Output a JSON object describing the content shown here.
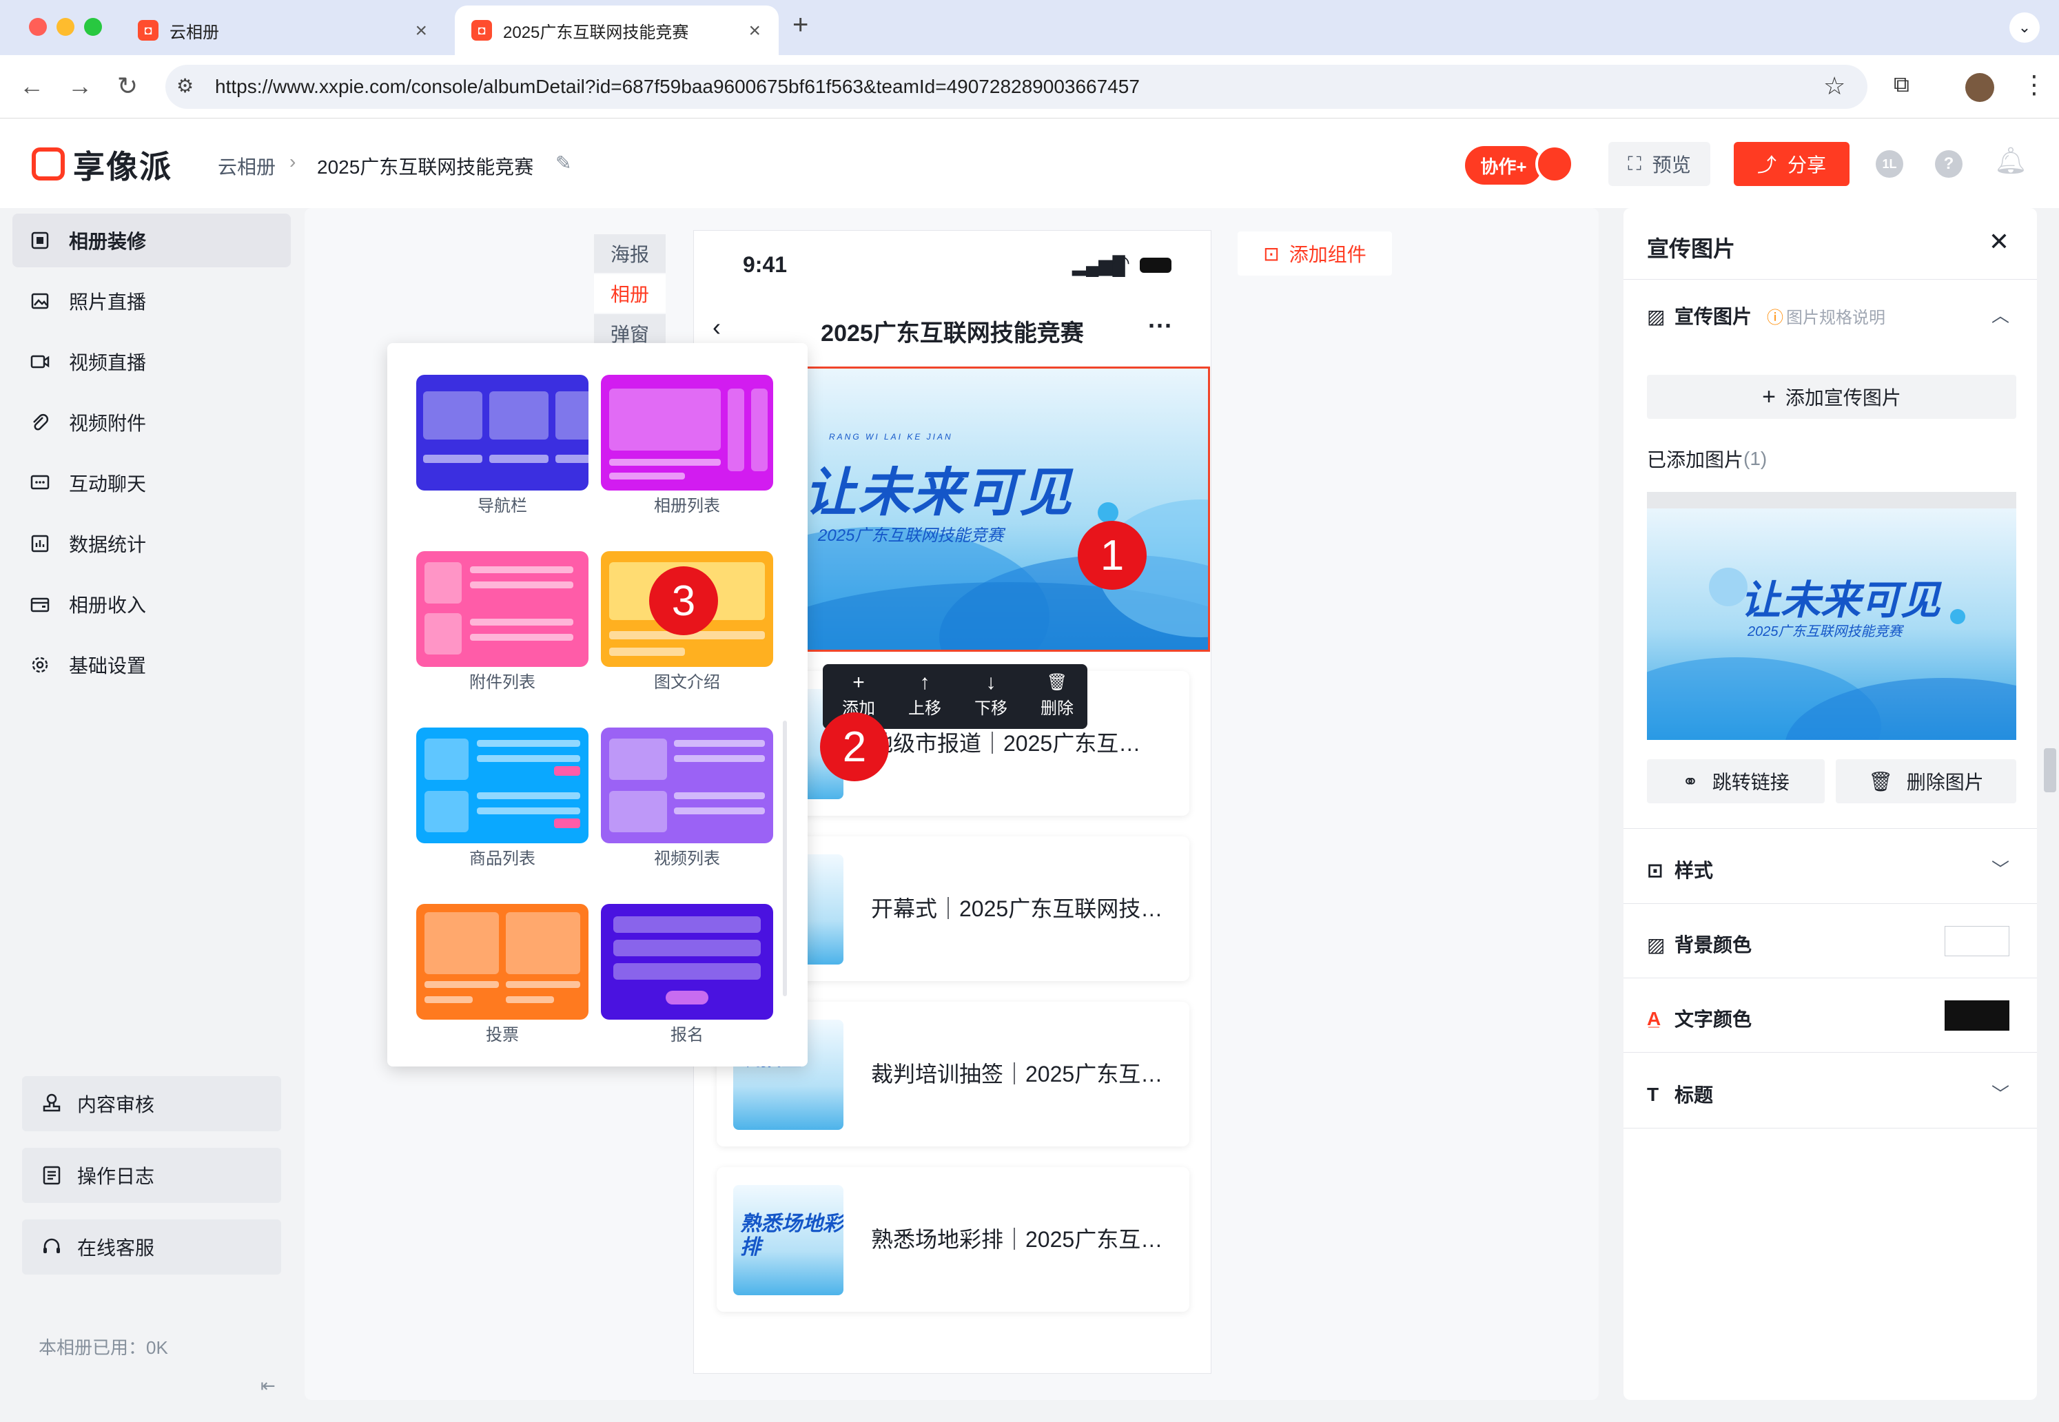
{
  "browser": {
    "tabs": [
      {
        "label": "云相册",
        "active": false
      },
      {
        "label": "2025广东互联网技能竞赛",
        "active": true
      }
    ],
    "new_tab": "+",
    "url": "https://www.xxpie.com/console/albumDetail?id=687f59baa9600675bf61f563&teamId=490728289003667457"
  },
  "header": {
    "brand": "享像派",
    "breadcrumb": [
      "云相册",
      "2025广东互联网技能竞赛"
    ],
    "collab_label": "协作+",
    "preview_label": "预览",
    "share_label": "分享",
    "badge_text": "1L"
  },
  "sidebar": {
    "items": [
      {
        "label": "相册装修",
        "icon": "layout-icon",
        "active": true
      },
      {
        "label": "照片直播",
        "icon": "image-icon"
      },
      {
        "label": "视频直播",
        "icon": "video-icon"
      },
      {
        "label": "视频附件",
        "icon": "paperclip-icon"
      },
      {
        "label": "互动聊天",
        "icon": "chat-icon"
      },
      {
        "label": "数据统计",
        "icon": "chart-icon"
      },
      {
        "label": "相册收入",
        "icon": "wallet-icon"
      },
      {
        "label": "基础设置",
        "icon": "gear-icon"
      }
    ],
    "bottom_buttons": [
      {
        "label": "内容审核",
        "icon": "stamp-icon"
      },
      {
        "label": "操作日志",
        "icon": "log-icon"
      },
      {
        "label": "在线客服",
        "icon": "headset-icon"
      }
    ],
    "usage": "本相册已用：0K"
  },
  "canvas": {
    "vertical_tabs": [
      {
        "label": "海报",
        "active": false
      },
      {
        "label": "相册",
        "active": true
      },
      {
        "label": "弹窗",
        "active": false
      }
    ],
    "add_component_label": "添加组件"
  },
  "phone": {
    "time": "9:41",
    "title": "2025广东互联网技能竞赛",
    "banner": {
      "pinyin": "RANG WI LAI KE JIAN",
      "title": "让未来可见",
      "subtitle": "2025广东互联网技能竞赛"
    },
    "toolbar": [
      {
        "label": "添加",
        "symbol": "+"
      },
      {
        "label": "上移",
        "symbol": "↑"
      },
      {
        "label": "下移",
        "symbol": "↓"
      },
      {
        "label": "删除",
        "symbol": "🗑"
      }
    ],
    "list": [
      {
        "thumb": "",
        "text": "地级市报道｜2025广东互…"
      },
      {
        "thumb": "",
        "text": "开幕式｜2025广东互联网技…"
      },
      {
        "thumb": "训抽签",
        "text": "裁判培训抽签｜2025广东互…"
      },
      {
        "thumb": "熟悉场地彩排",
        "text": "熟悉场地彩排｜2025广东互…"
      }
    ]
  },
  "picker": {
    "components": [
      {
        "label": "导航栏",
        "color": "#3b2fe0"
      },
      {
        "label": "相册列表",
        "color": "#d21cf0"
      },
      {
        "label": "附件列表",
        "color": "#ff5ca8"
      },
      {
        "label": "图文介绍",
        "color": "#ffb020"
      },
      {
        "label": "商品列表",
        "color": "#0aa8ff"
      },
      {
        "label": "视频列表",
        "color": "#9b62f5"
      },
      {
        "label": "投票",
        "color": "#ff7a1f"
      },
      {
        "label": "报名",
        "color": "#4a12e0"
      }
    ]
  },
  "markers": [
    "1",
    "2",
    "3"
  ],
  "right_panel": {
    "title": "宣传图片",
    "section_label": "宣传图片",
    "spec_link": "图片规格说明",
    "add_button": "添加宣传图片",
    "added_label": "已添加图片",
    "added_count": "(1)",
    "jump_link": "跳转链接",
    "delete_image": "删除图片",
    "rows": [
      {
        "label": "样式",
        "icon": "style-icon"
      },
      {
        "label": "背景颜色",
        "icon": "fill-icon",
        "swatch": "#ffffff"
      },
      {
        "label": "文字颜色",
        "icon": "text-color-icon",
        "swatch": "#111111"
      },
      {
        "label": "标题",
        "icon": "title-icon"
      }
    ]
  },
  "colors": {
    "accent": "#ff3b22",
    "marker": "#e8141b"
  }
}
